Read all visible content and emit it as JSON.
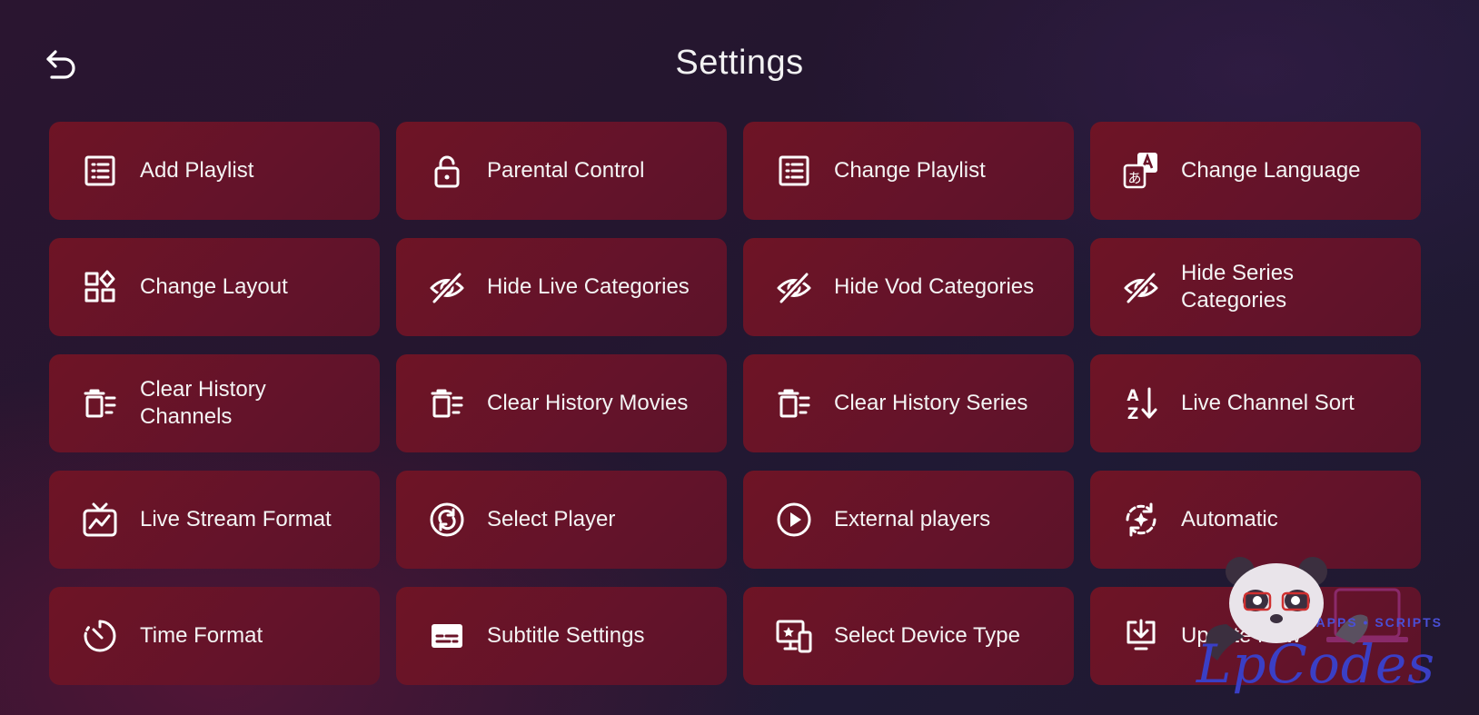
{
  "header": {
    "title": "Settings",
    "back_icon": "back-arrow-icon"
  },
  "tiles": [
    {
      "label": "Add Playlist",
      "icon": "list-icon"
    },
    {
      "label": "Parental Control",
      "icon": "lock-icon"
    },
    {
      "label": "Change Playlist",
      "icon": "list-icon"
    },
    {
      "label": "Change Language",
      "icon": "translate-icon"
    },
    {
      "label": "Change Layout",
      "icon": "layout-icon"
    },
    {
      "label": "Hide Live Categories",
      "icon": "eye-off-icon"
    },
    {
      "label": "Hide Vod Categories",
      "icon": "eye-off-icon"
    },
    {
      "label": "Hide Series Categories",
      "icon": "eye-off-icon"
    },
    {
      "label": "Clear History Channels",
      "icon": "clear-history-icon"
    },
    {
      "label": "Clear History Movies",
      "icon": "clear-history-icon"
    },
    {
      "label": "Clear History Series",
      "icon": "clear-history-icon"
    },
    {
      "label": "Live Channel Sort",
      "icon": "sort-az-icon"
    },
    {
      "label": "Live Stream Format",
      "icon": "tv-icon"
    },
    {
      "label": "Select Player",
      "icon": "sync-circle-icon"
    },
    {
      "label": "External players",
      "icon": "play-circle-icon"
    },
    {
      "label": "Automatic",
      "icon": "auto-refresh-icon"
    },
    {
      "label": "Time Format",
      "icon": "timer-icon"
    },
    {
      "label": "Subtitle Settings",
      "icon": "subtitles-icon"
    },
    {
      "label": "Select Device Type",
      "icon": "devices-icon"
    },
    {
      "label": "Update Now",
      "icon": "download-icon"
    }
  ],
  "watermark": {
    "text": "LpCodes",
    "subtext": "APPS • SCRIPTS"
  },
  "colors": {
    "tile": "#6a1428",
    "watermark": "#3a3fc6"
  }
}
